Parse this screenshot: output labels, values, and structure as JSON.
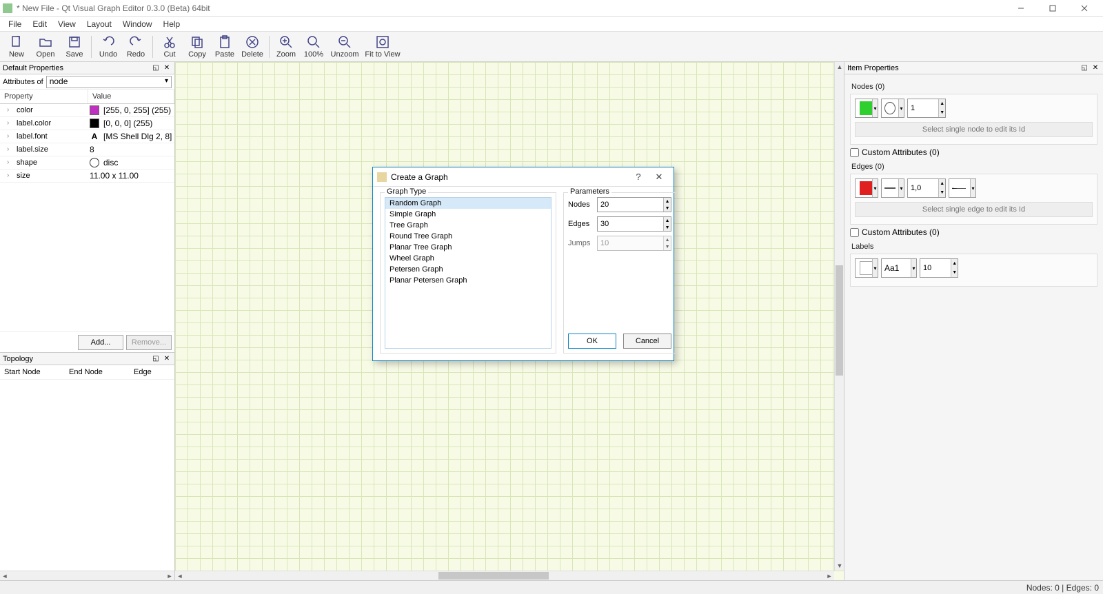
{
  "window": {
    "title": "* New File - Qt Visual Graph Editor 0.3.0 (Beta) 64bit"
  },
  "menu": [
    "File",
    "Edit",
    "View",
    "Layout",
    "Window",
    "Help"
  ],
  "toolbar": {
    "new": "New",
    "open": "Open",
    "save": "Save",
    "undo": "Undo",
    "redo": "Redo",
    "cut": "Cut",
    "copy": "Copy",
    "paste": "Paste",
    "delete": "Delete",
    "zoom": "Zoom",
    "zoom100": "100%",
    "unzoom": "Unzoom",
    "fit": "Fit to View"
  },
  "leftPanel": {
    "defaultProps": {
      "title": "Default Properties",
      "attributesOfLabel": "Attributes of",
      "attributesOfValue": "node",
      "columns": {
        "property": "Property",
        "value": "Value"
      },
      "rows": [
        {
          "name": "color",
          "value": "[255, 0, 255] (255)",
          "swatch": "#c030c0"
        },
        {
          "name": "label.color",
          "value": "[0, 0, 0] (255)",
          "swatch": "#000000"
        },
        {
          "name": "label.font",
          "value": "[MS Shell Dlg 2, 8]",
          "icon": "A"
        },
        {
          "name": "label.size",
          "value": "8"
        },
        {
          "name": "shape",
          "value": "disc",
          "shape": "disc"
        },
        {
          "name": "size",
          "value": "11.00 x 11.00"
        }
      ],
      "addBtn": "Add...",
      "removeBtn": "Remove..."
    },
    "topology": {
      "title": "Topology",
      "columns": {
        "start": "Start Node",
        "end": "End Node",
        "edge": "Edge"
      }
    }
  },
  "rightPanel": {
    "title": "Item Properties",
    "nodes": {
      "title": "Nodes (0)",
      "color": "#2fcf2f",
      "width": "1",
      "hint": "Select single node to edit its Id",
      "customAttr": "Custom Attributes (0)"
    },
    "edges": {
      "title": "Edges (0)",
      "color": "#e02020",
      "weight": "1,0",
      "hint": "Select single edge to edit its Id",
      "customAttr": "Custom Attributes (0)"
    },
    "labels": {
      "title": "Labels",
      "color": "#ffffff",
      "font": "Aa1",
      "size": "10"
    }
  },
  "dialog": {
    "title": "Create a Graph",
    "graphTypeLabel": "Graph Type",
    "types": [
      "Random Graph",
      "Simple Graph",
      "Tree Graph",
      "Round Tree Graph",
      "Planar Tree Graph",
      "Wheel Graph",
      "Petersen Graph",
      "Planar Petersen Graph"
    ],
    "parametersLabel": "Parameters",
    "params": {
      "nodesLabel": "Nodes",
      "nodesValue": "20",
      "edgesLabel": "Edges",
      "edgesValue": "30",
      "jumpsLabel": "Jumps",
      "jumpsValue": "10"
    },
    "okBtn": "OK",
    "cancelBtn": "Cancel"
  },
  "statusbar": {
    "text": "Nodes: 0 | Edges: 0"
  }
}
